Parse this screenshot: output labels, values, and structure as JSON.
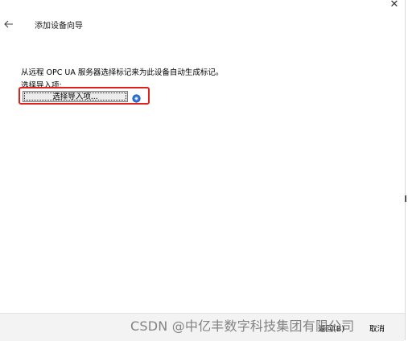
{
  "wizard": {
    "title": "添加设备向导",
    "back_icon": "arrow-left-icon",
    "close_icon": "close-icon",
    "close_glyph": "✕"
  },
  "content": {
    "description": "从远程 OPC UA 服务器选择标记来为此设备自动生成标记。",
    "import_label": "选择导入项:",
    "select_button_label": "选择导入项...",
    "help_icon": "help-icon"
  },
  "footer": {
    "back_label": "返回",
    "back_shortcut": "(B)",
    "cancel_label": "取消"
  },
  "watermark": {
    "text": "CSDN @中亿丰数字科技集团有限公司"
  },
  "colors": {
    "highlight": "#e0211c",
    "help_icon": "#2b6fd1",
    "footer_bg": "#f3f3f3"
  }
}
